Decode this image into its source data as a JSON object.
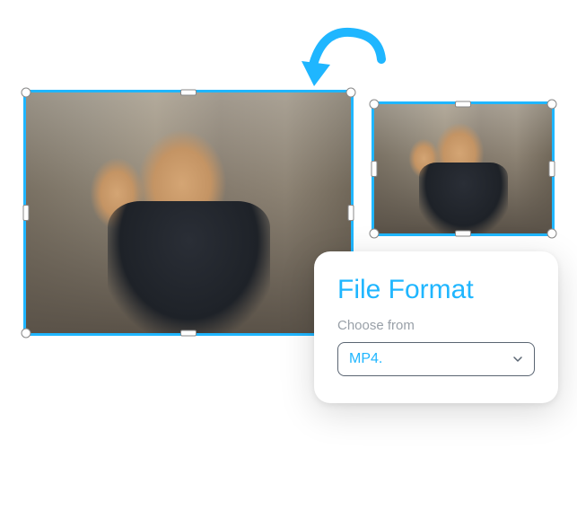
{
  "panel": {
    "title": "File Format",
    "label": "Choose from",
    "selected": "MP4."
  },
  "colors": {
    "accent": "#1fb6ff"
  },
  "icons": {
    "arrow": "curved-arrow-icon",
    "chevron": "chevron-down-icon"
  }
}
